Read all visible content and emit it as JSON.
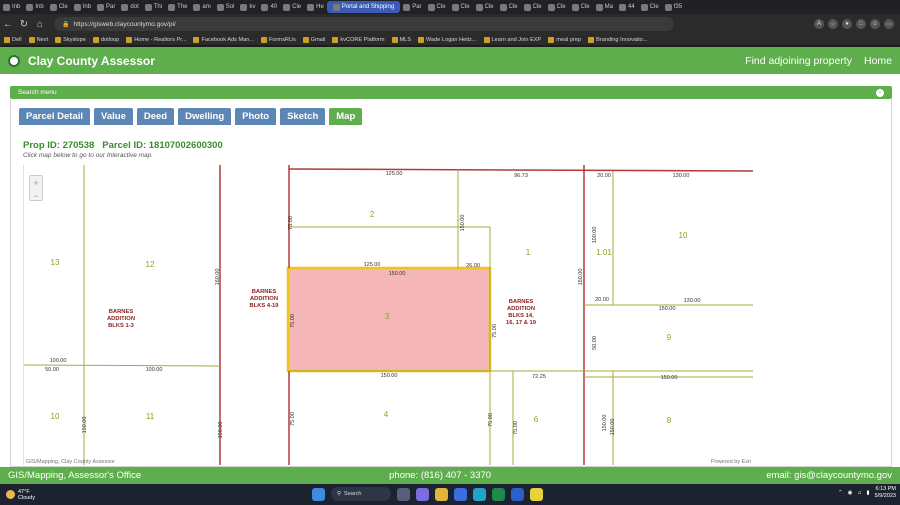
{
  "browser": {
    "tabs": [
      "Inb",
      "Inb",
      "Cle",
      "Inb",
      "Par",
      "dot",
      "Thi",
      "The",
      "am",
      "Sol",
      "kv",
      "40",
      "Cle",
      "He",
      "Portal and Shipping",
      "Par",
      "Cle",
      "Cle",
      "Cle",
      "Cle",
      "Cle",
      "Cle",
      "Cle",
      "Ma",
      "44",
      "Cle",
      "f35"
    ],
    "active_tab_index": 14,
    "url": "https://gisweb.claycountymo.gov/pi/",
    "bookmarks": [
      "Dell",
      "Next",
      "Skyslope",
      "dotloop",
      "Home - Realtors Pr...",
      "Facebook Ads Man...",
      "FormsRUs",
      "Gmail",
      "kvCORE Platform",
      "MLS",
      "Wade Logan Heitz...",
      "Learn and Join EXP",
      "meal prep",
      "Branding Innovatio..."
    ]
  },
  "site": {
    "title": "Clay County Assessor",
    "nav": [
      "Find adjoining property",
      "Home"
    ]
  },
  "search_menu": {
    "label": "Search menu",
    "toggle": "-"
  },
  "tabs": [
    {
      "label": "Parcel Detail",
      "active": false
    },
    {
      "label": "Value",
      "active": false
    },
    {
      "label": "Deed",
      "active": false
    },
    {
      "label": "Dwelling",
      "active": false
    },
    {
      "label": "Photo",
      "active": false
    },
    {
      "label": "Sketch",
      "active": false
    },
    {
      "label": "Map",
      "active": true
    }
  ],
  "ids": {
    "prop": "Prop ID: 270538",
    "parcel": "Parcel ID: 18107002600300"
  },
  "hint": "Click map below to go to our Interactive map.",
  "map": {
    "zoom_in": "+",
    "zoom_out": "−",
    "subdivisions": [
      "BARNES ADDITION BLKS 1-3",
      "BARNES ADDITION BLKS 4-19",
      "BARNES ADDITION BLKS 14, 16, 17 & 19"
    ],
    "lot_numbers": [
      "13",
      "12",
      "2",
      "1",
      "1.01",
      "10",
      "3",
      "9",
      "10",
      "11",
      "4",
      "6",
      "8"
    ],
    "dimensions": [
      "125.00",
      "96.73",
      "20.00",
      "130.00",
      "75.00",
      "150.00",
      "160.00",
      "125.00",
      "150.00",
      "26.00",
      "100.00",
      "150.00",
      "20.00",
      "130.00",
      "75.00",
      "75.00",
      "150.00",
      "50.00",
      "100.00",
      "50.00",
      "100.00",
      "150.00",
      "72.25",
      "150.00",
      "75.00",
      "150.00",
      "150.00",
      "75.00",
      "75.00",
      "150.00",
      "150.00"
    ],
    "credit_left": "GIS/Mapping, Clay County Assessor",
    "credit_right": "Powered by Esri",
    "colors": {
      "selected_fill": "#f4b6b6",
      "selected_outline": "#f0c419",
      "line": "#a6ad3a",
      "road": "#b03a3a",
      "lot_label": "#8aa21f",
      "subdiv_label": "#8b1d1d"
    }
  },
  "footer": {
    "left": "GIS/Mapping, Assessor's Office",
    "phone": "phone: (816) 407 - 3370",
    "email": "email: gis@claycountymo.gov"
  },
  "taskbar": {
    "temp": "47°F",
    "weather": "Cloudy",
    "search": "Search",
    "time": "6:13 PM",
    "date": "5/9/2023"
  }
}
